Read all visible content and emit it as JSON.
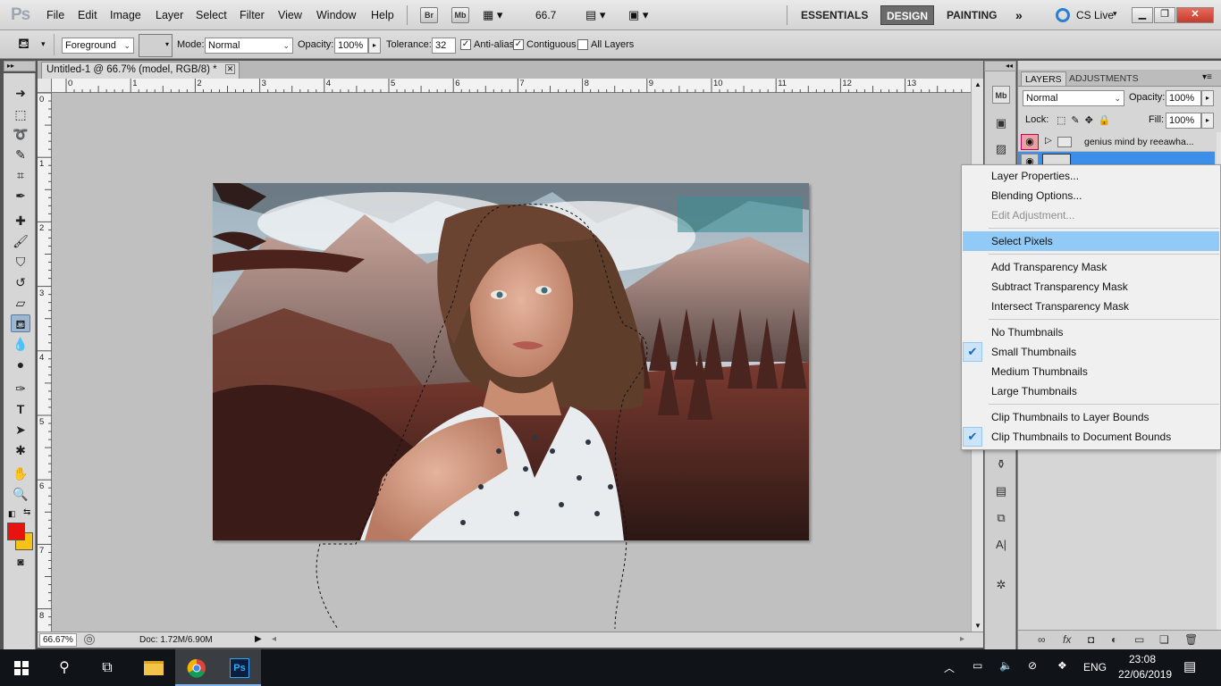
{
  "app": {
    "logo": "Ps"
  },
  "menu": [
    "File",
    "Edit",
    "Image",
    "Layer",
    "Select",
    "Filter",
    "View",
    "Window",
    "Help"
  ],
  "app_bar": {
    "bridge": "Br",
    "minibridge": "Mb",
    "zoom": "66.7"
  },
  "workspaces": [
    "ESSENTIALS",
    "DESIGN",
    "PAINTING"
  ],
  "cs_live": "CS Live",
  "options": {
    "fill_source": "Foreground",
    "mode_label": "Mode:",
    "mode": "Normal",
    "opacity_label": "Opacity:",
    "opacity": "100%",
    "tolerance_label": "Tolerance:",
    "tolerance": "32",
    "antialias": "Anti-alias",
    "contiguous": "Contiguous",
    "all_layers": "All Layers"
  },
  "document": {
    "tab_title": "Untitled-1 @ 66.7% (model, RGB/8) *",
    "ruler_h": [
      "0",
      "1",
      "2",
      "3",
      "4",
      "5",
      "6",
      "7",
      "8",
      "9",
      "10",
      "11",
      "12",
      "13",
      "1"
    ],
    "ruler_v": [
      "0",
      "1",
      "2",
      "3",
      "4",
      "5",
      "6",
      "7",
      "8"
    ]
  },
  "status": {
    "zoom": "66.67%",
    "doc": "Doc: 1.72M/6.90M"
  },
  "layers_panel": {
    "tabs": [
      "LAYERS",
      "ADJUSTMENTS"
    ],
    "blend": "Normal",
    "opacity_label": "Opacity:",
    "opacity": "100%",
    "lock_label": "Lock:",
    "fill_label": "Fill:",
    "fill": "100%",
    "layers": [
      {
        "name": "genius mind by reeawha..."
      }
    ]
  },
  "context_menu": {
    "items": [
      {
        "label": "Layer Properties...",
        "state": "normal"
      },
      {
        "label": "Blending Options...",
        "state": "normal"
      },
      {
        "label": "Edit Adjustment...",
        "state": "disabled"
      },
      {
        "label": "Select Pixels",
        "state": "highlight"
      },
      {
        "label": "Add Transparency Mask",
        "state": "normal"
      },
      {
        "label": "Subtract Transparency Mask",
        "state": "normal"
      },
      {
        "label": "Intersect Transparency Mask",
        "state": "normal"
      },
      {
        "label": "No Thumbnails",
        "state": "normal"
      },
      {
        "label": "Small Thumbnails",
        "state": "checked"
      },
      {
        "label": "Medium Thumbnails",
        "state": "normal"
      },
      {
        "label": "Large Thumbnails",
        "state": "normal"
      },
      {
        "label": "Clip Thumbnails to Layer Bounds",
        "state": "normal"
      },
      {
        "label": "Clip Thumbnails to Document Bounds",
        "state": "checked"
      }
    ]
  },
  "colors": {
    "foreground": "#e8130f",
    "background": "#f6c216",
    "highlight": "#91c9f7"
  },
  "taskbar": {
    "language": "ENG",
    "time": "23:08",
    "date": "22/06/2019"
  }
}
